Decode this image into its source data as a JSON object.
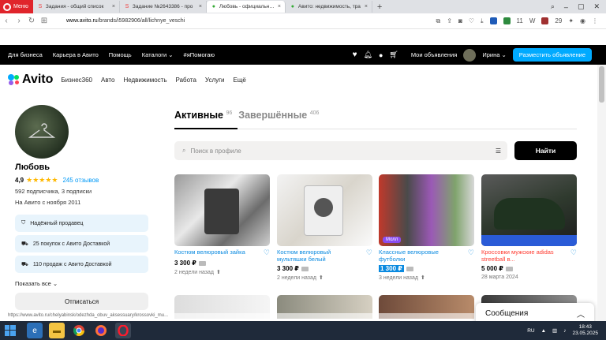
{
  "browser": {
    "menu_label": "Меню",
    "tabs": [
      {
        "title": "Задания - общий список",
        "fav_color": "#e44"
      },
      {
        "title": "Задание №2643386 - про",
        "fav_color": "#e44"
      },
      {
        "title": "Любовь - официальная с",
        "fav_color": "#3a3",
        "active": true
      },
      {
        "title": "Авито: недвижимость, тра",
        "fav_color": "#3a3"
      }
    ],
    "url_host": "www.avito.ru",
    "url_path": "/brands/i5982906/all/lichnye_veschi",
    "ext_badge_count": "11",
    "ext_badge_count2": "29"
  },
  "topnav": {
    "links": [
      "Для бизнеса",
      "Карьера в Авито",
      "Помощь",
      "Каталоги ⌄",
      "#яПомогаю"
    ],
    "my_ads": "Мои объявления",
    "user": "Ирина ⌄",
    "place_ad": "Разместить объявление"
  },
  "subnav": {
    "logo": "Avito",
    "links": [
      "Бизнес360",
      "Авто",
      "Недвижимость",
      "Работа",
      "Услуги",
      "Ещё"
    ]
  },
  "profile": {
    "name": "Любовь",
    "rating": "4,9",
    "stars": "★★★★★",
    "reviews": "245 отзывов",
    "subscribers": "592 подписчика, 3 подписки",
    "since": "На Авито с ноября 2011",
    "badges": [
      "Надёжный продавец",
      "25 покупок с Авито Доставкой",
      "110 продаж с Авито Доставкой"
    ],
    "show_all": "Показать все",
    "unsubscribe": "Отписаться"
  },
  "tabs": {
    "active_label": "Активные",
    "active_count": "96",
    "done_label": "Завершённые",
    "done_count": "406"
  },
  "search": {
    "placeholder": "Поиск в профиле",
    "button": "Найти"
  },
  "listings": [
    {
      "title": "Костюм велюровый зайка",
      "price": "3 300 ₽",
      "date": "2 недели назад",
      "highlight": false
    },
    {
      "title": "Костюм велюровый мультяшки белый",
      "price": "3 300 ₽",
      "date": "2 недели назад",
      "highlight": false
    },
    {
      "title": "Классные велюровые футболки",
      "price": "1 300 ₽",
      "date": "3 недели назад",
      "highlight": true,
      "badge": "Молл"
    },
    {
      "title": "Кроссовки мужские adidas streetball в...",
      "price": "5 000 ₽",
      "date": "28 марта 2024",
      "highlight": false,
      "red": true
    }
  ],
  "messages": "Сообщения",
  "status_url": "https://www.avito.ru/chelyabinsk/odezhda_obuv_aksessuary/krossovki_mu...",
  "taskbar": {
    "lang": "RU",
    "time": "18:43",
    "date": "23.05.2025"
  },
  "colors": {
    "accent": "#00aaff",
    "link": "#0a8ae0",
    "topnav_bg": "#000000",
    "opera_red": "#e0242b"
  }
}
